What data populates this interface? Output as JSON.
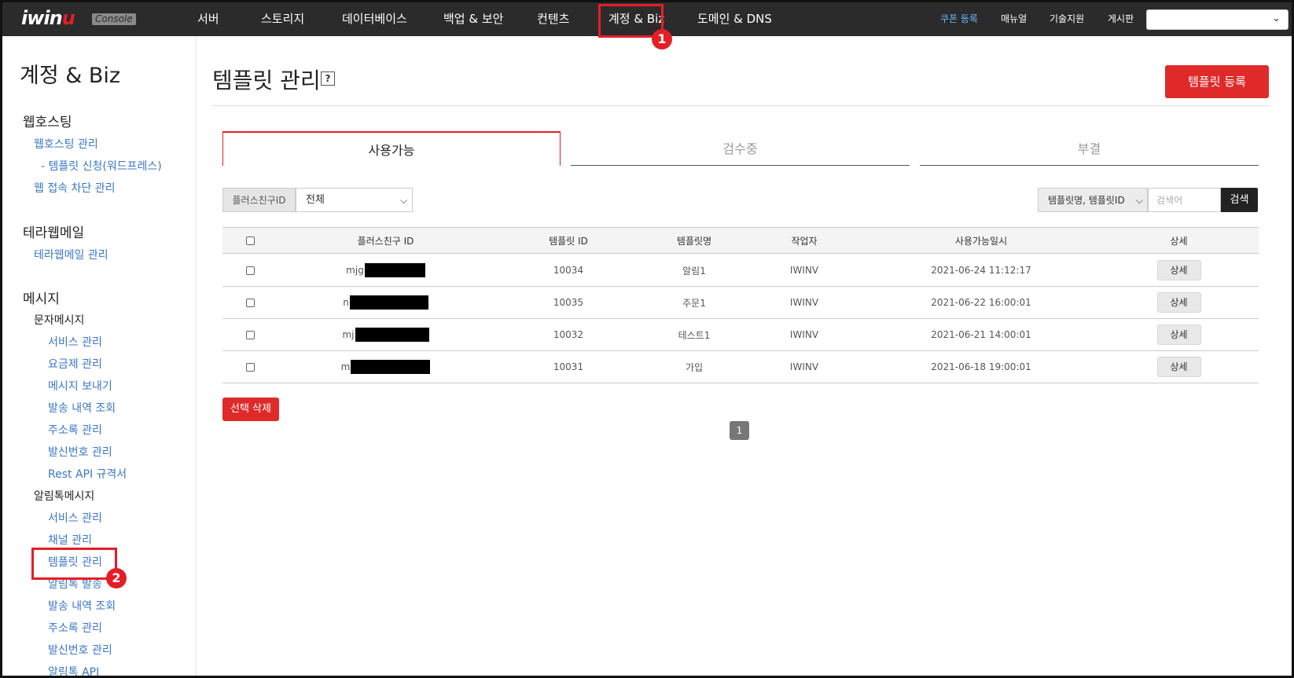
{
  "header": {
    "logo_text": "iwin",
    "logo_u": "u",
    "logo_badge": "Console",
    "nav": [
      "서버",
      "스토리지",
      "데이터베이스",
      "백업 & 보안",
      "컨텐츠",
      "계정 & Biz",
      "도메인 & DNS"
    ],
    "links": {
      "coupon": "쿠폰 등록",
      "manual": "매뉴얼",
      "support": "기술지원",
      "board": "게시판"
    },
    "select_value": ""
  },
  "annotations": {
    "one": "1",
    "two": "2"
  },
  "sidebar": {
    "title": "계정 & Biz",
    "webhosting": {
      "heading": "웹호스팅",
      "items": [
        "웹호스팅 관리",
        "- 템플릿 신청(워드프레스)",
        "웹 접속 차단 관리"
      ]
    },
    "terramail": {
      "heading": "테라웹메일",
      "items": [
        "테라웹메일 관리"
      ]
    },
    "message": {
      "heading": "메시지",
      "sms": {
        "heading": "문자메시지",
        "items": [
          "서비스 관리",
          "요금제 관리",
          "메시지 보내기",
          "발송 내역 조회",
          "주소록 관리",
          "발신번호 관리",
          "Rest API 규격서"
        ]
      },
      "alimtalk": {
        "heading": "알림톡메시지",
        "items": [
          "서비스 관리",
          "채널 관리",
          "템플릿 관리",
          "알림톡 발송",
          "발송 내역 조회",
          "주소록 관리",
          "발신번호 관리",
          "알림톡 API"
        ]
      }
    }
  },
  "main": {
    "title": "템플릿 관리",
    "help": "?",
    "register_label": "템플릿 등록",
    "tabs": [
      "사용가능",
      "검수중",
      "부결"
    ],
    "filter": {
      "label": "플러스친구ID",
      "value": "전체"
    },
    "search": {
      "type_value": "템플릿명, 템플릿ID",
      "placeholder": "검색어",
      "button": "검색"
    },
    "table": {
      "headers": [
        "플러스친구 ID",
        "템플릿 ID",
        "템플릿명",
        "작업자",
        "사용가능일시",
        "상세"
      ],
      "rows": [
        {
          "friend_id": "mjg",
          "template_id": "10034",
          "name": "알림1",
          "worker": "IWINV",
          "date": "2021-06-24 11:12:17",
          "detail": "상세"
        },
        {
          "friend_id": "n",
          "template_id": "10035",
          "name": "주문1",
          "worker": "IWINV",
          "date": "2021-06-22 16:00:01",
          "detail": "상세"
        },
        {
          "friend_id": "mj",
          "template_id": "10032",
          "name": "테스트1",
          "worker": "IWINV",
          "date": "2021-06-21 14:00:01",
          "detail": "상세"
        },
        {
          "friend_id": "m",
          "template_id": "10031",
          "name": "가입",
          "worker": "IWINV",
          "date": "2021-06-18 19:00:01",
          "detail": "상세"
        }
      ]
    },
    "delete_label": "선택 삭제",
    "page": "1"
  }
}
